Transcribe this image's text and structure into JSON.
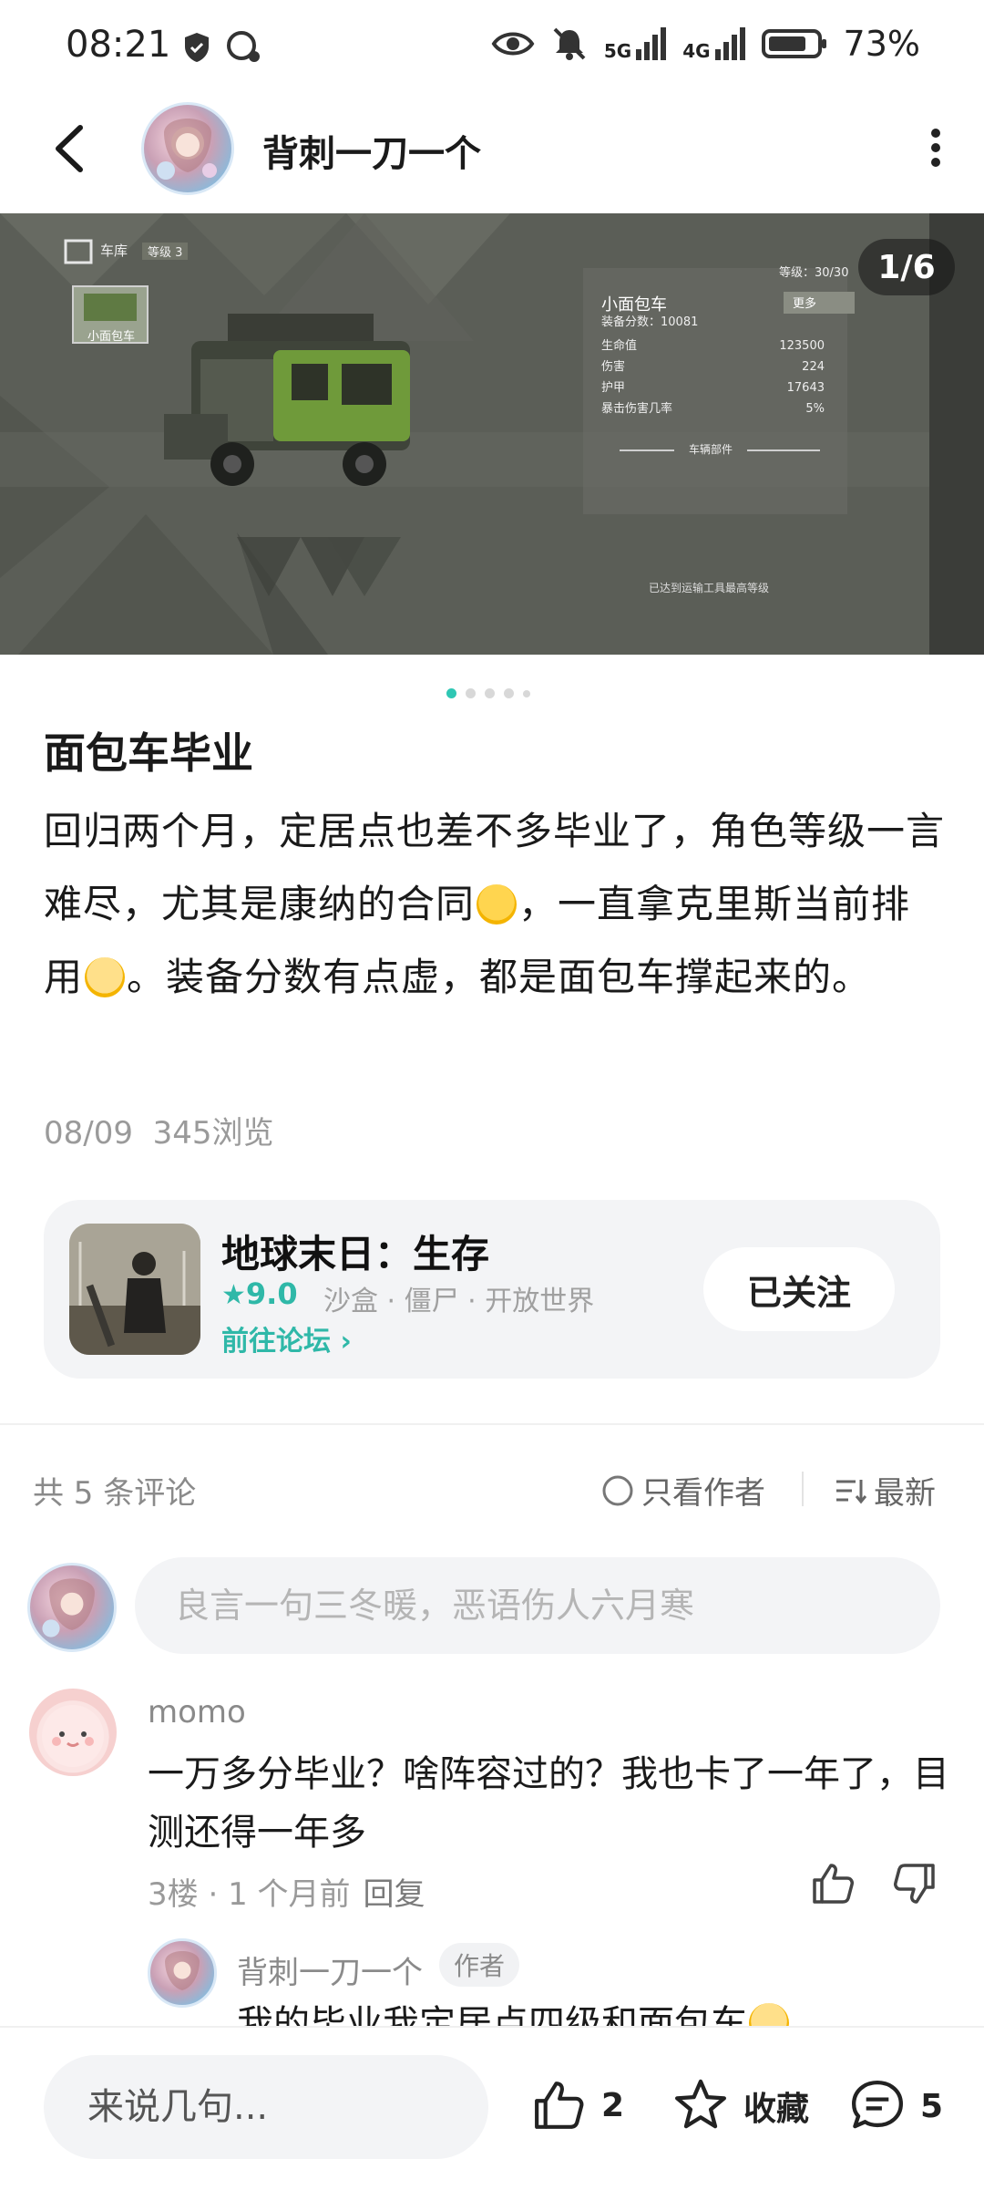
{
  "status_bar": {
    "time": "08:21",
    "battery": "73%",
    "network_5g": "5G",
    "network_4g": "4G",
    "icons": [
      "shield-icon",
      "chat-bubble-icon",
      "eye-icon",
      "bell-off-icon",
      "signal-icon",
      "battery-icon"
    ]
  },
  "header": {
    "author_name": "背刺一刀一个"
  },
  "gallery": {
    "counter": "1/6"
  },
  "hero_image": {
    "garage_label": "车库",
    "garage_level": "等级 3",
    "thumb_label": "小面包车",
    "level": "等级：30/30",
    "vehicle_name": "小面包车",
    "gear_score_label": "装备分数：",
    "gear_score": "10081",
    "more": "更多",
    "stats": [
      {
        "label": "生命值",
        "value": "123500"
      },
      {
        "label": "伤害",
        "value": "224"
      },
      {
        "label": "护甲",
        "value": "17643"
      },
      {
        "label": "暴击伤害几率",
        "value": "5%"
      }
    ],
    "parts_label": "车辆部件",
    "max_level_note": "已达到运输工具最高等级"
  },
  "post": {
    "title": "面包车毕业",
    "body_part1": "回归两个月，定居点也差不多毕业了，角色等级一言难尽，尤其是康纳的合同",
    "body_part2": "，一直拿克里斯当前排用",
    "body_part3": "。装备分数有点虚，都是面包车撑起来的。",
    "date": "08/09",
    "views": "345浏览"
  },
  "game": {
    "name": "地球末日：生存",
    "rating": "9.0",
    "tags": "沙盒 · 僵尸 · 开放世界",
    "forum_link": "前往论坛",
    "follow_label": "已关注"
  },
  "comments": {
    "count_label": "共 5 条评论",
    "only_author": "只看作者",
    "sort": "最新",
    "input_placeholder": "良言一句三冬暖，恶语伤人六月寒",
    "items": [
      {
        "user": "momo",
        "text": "一万多分毕业？啥阵容过的？我也卡了一年了，目测还得一年多",
        "floor": "3楼",
        "time": "1 个月前",
        "reply_label": "回复"
      }
    ],
    "reply": {
      "user": "背刺一刀一个",
      "badge": "作者",
      "text": "我的毕业我定居点四级和面包车"
    }
  },
  "bottom_bar": {
    "input_placeholder": "来说几句...",
    "like_count": "2",
    "favorite_label": "收藏",
    "comment_count": "5"
  },
  "colors": {
    "accent": "#2fc7b4",
    "text": "#1a1a1a",
    "muted": "#9a9a9a",
    "card_bg": "#f3f4f6"
  }
}
